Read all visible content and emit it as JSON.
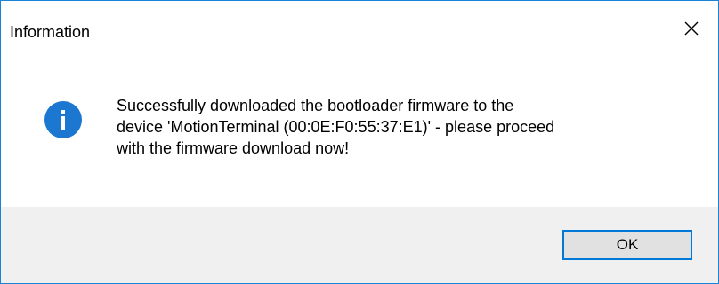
{
  "dialog": {
    "title": "Information",
    "close_icon": "close-icon",
    "message_lines": [
      "Successfully downloaded the bootloader firmware to the",
      "device 'MotionTerminal (00:0E:F0:55:37:E1)' - please proceed",
      "with the firmware download now!"
    ],
    "icon": "information-icon",
    "ok_label": "OK"
  },
  "colors": {
    "border": "#1883d7",
    "icon_blue": "#1c77d1",
    "footer_bg": "#f0f0f0",
    "button_bg": "#e1e1e1",
    "button_border": "#0078d7"
  }
}
